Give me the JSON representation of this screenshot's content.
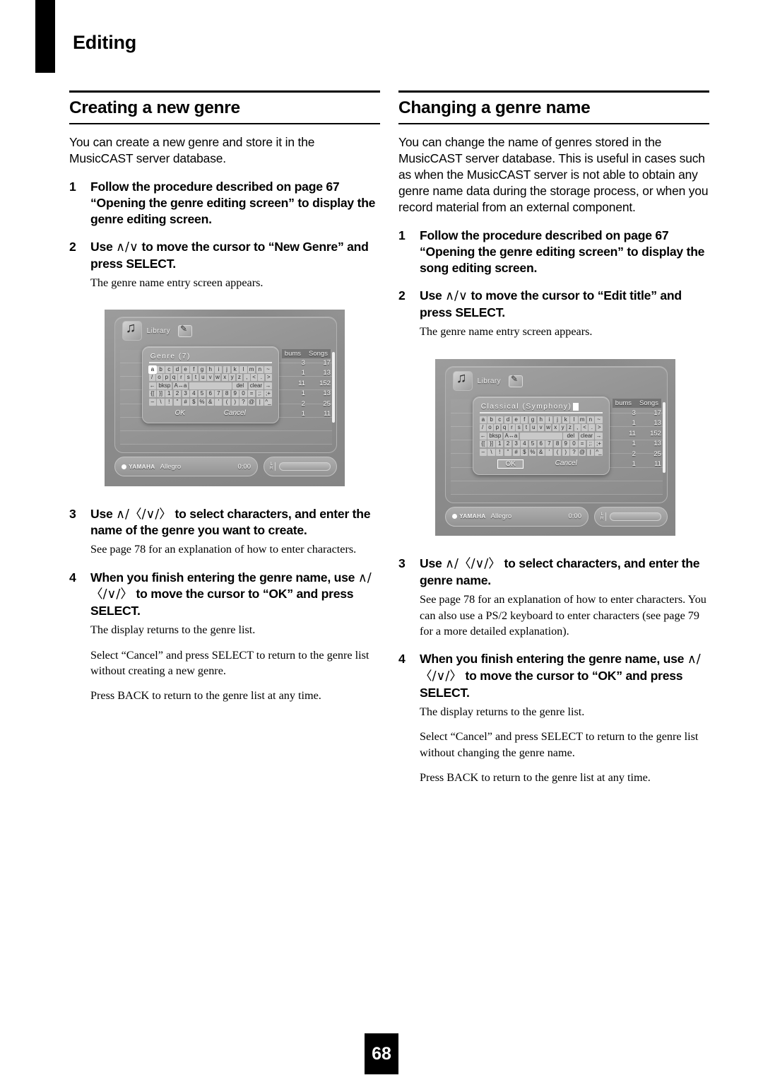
{
  "chapter": {
    "title": "Editing"
  },
  "footer": {
    "page_number": "68"
  },
  "left": {
    "heading": "Creating a new genre",
    "intro": "You can create a new genre and store it in the MusicCAST server database.",
    "steps": [
      {
        "num": "1",
        "title": "Follow the procedure described on page 67 “Opening the genre editing screen” to display the genre editing screen.",
        "notes": []
      },
      {
        "num": "2",
        "title_pre": "Use ",
        "title_glyph": "∧/∨",
        "title_post": " to move the cursor to “New Genre” and press SELECT.",
        "notes": [
          "The genre name entry screen appears."
        ]
      },
      {
        "num": "3",
        "title_pre": "Use ",
        "title_glyph": "∧/〈/∨/〉",
        "title_post": " to select characters, and enter the name of the genre you want to create.",
        "notes": [
          "See page 78 for an explanation of how to enter characters."
        ]
      },
      {
        "num": "4",
        "title_pre": "When you finish entering the genre name, use ",
        "title_glyph": "∧/〈/∨/〉",
        "title_post": " to move the cursor to “OK” and press SELECT.",
        "notes": [
          "The display returns to the genre list.",
          "Select “Cancel” and press SELECT to return to the genre list without creating a new genre.",
          "Press BACK to return to the genre list at any time."
        ]
      }
    ],
    "screenshot": {
      "header_label": "Library",
      "entry_text": "Genre (7)",
      "show_caret": false,
      "selected_key": "a",
      "ok_label": "OK",
      "cancel_label": "Cancel",
      "ok_selected": false,
      "col_headers": [
        "bums",
        "Songs"
      ],
      "stats": [
        [
          "3",
          "17"
        ],
        [
          "1",
          "13"
        ],
        [
          "11",
          "152"
        ],
        [
          "1",
          "13"
        ],
        [
          "2",
          "25"
        ],
        [
          "1",
          "11"
        ]
      ],
      "brand": "YAMAHA",
      "track": "Allegro",
      "time": "0:00",
      "vol_l": "L",
      "vol_r": "R"
    }
  },
  "right": {
    "heading": "Changing a genre name",
    "intro": "You can change the name of genres stored in the MusicCAST server database. This is useful in cases such as when the MusicCAST server is not able to obtain any genre name data during the storage process, or when you record material from an external component.",
    "steps": [
      {
        "num": "1",
        "title": "Follow the procedure described on page 67 “Opening the genre editing screen” to display the song editing screen.",
        "notes": []
      },
      {
        "num": "2",
        "title_pre": "Use ",
        "title_glyph": "∧/∨",
        "title_post": " to move the cursor to “Edit title” and press SELECT.",
        "notes": [
          "The genre name entry screen appears."
        ]
      },
      {
        "num": "3",
        "title_pre": "Use ",
        "title_glyph": "∧/〈/∨/〉",
        "title_post": " to select characters, and enter the genre name.",
        "notes": [
          "See page 78 for an explanation of how to enter characters. You can also use a PS/2 keyboard to enter characters (see page 79 for a more detailed explanation)."
        ]
      },
      {
        "num": "4",
        "title_pre": "When you finish entering the genre name, use ",
        "title_glyph": "∧/〈/∨/〉",
        "title_post": " to move the cursor to “OK” and press SELECT.",
        "notes": [
          "The display returns to the genre list.",
          "Select “Cancel” and press SELECT to return to the genre list without changing the genre name.",
          "Press BACK to return to the genre list at any time."
        ]
      }
    ],
    "screenshot": {
      "header_label": "Library",
      "entry_text": "Classical (Symphony)",
      "show_caret": true,
      "selected_key": "",
      "ok_label": "OK",
      "cancel_label": "Cancel",
      "ok_selected": true,
      "col_headers": [
        "bums",
        "Songs"
      ],
      "stats": [
        [
          "3",
          "17"
        ],
        [
          "1",
          "13"
        ],
        [
          "11",
          "152"
        ],
        [
          "1",
          "13"
        ],
        [
          "2",
          "25"
        ],
        [
          "1",
          "11"
        ]
      ],
      "brand": "YAMAHA",
      "track": "Allegro",
      "time": "0:00",
      "vol_l": "L",
      "vol_r": "R"
    }
  },
  "keyboard": {
    "rows": [
      [
        "a",
        "b",
        "c",
        "d",
        "e",
        "f",
        "g",
        "h",
        "i",
        "j",
        "k",
        "l",
        "m",
        "n",
        "~"
      ],
      [
        "/",
        "o",
        "p",
        "q",
        "r",
        "s",
        "t",
        "u",
        "v",
        "w",
        "x",
        "y",
        "z",
        ",",
        "<",
        ".",
        ">"
      ],
      [
        "←",
        "bksp",
        "A↔a",
        "",
        "del",
        "clear",
        "→"
      ],
      [
        "{[",
        "}]",
        "1",
        "2",
        "3",
        "4",
        "5",
        "6",
        "7",
        "8",
        "9",
        "0",
        "=",
        ";:",
        ";+"
      ],
      [
        "–",
        "\\",
        "!",
        "\"",
        "#",
        "$",
        "%",
        "&",
        "'",
        "(",
        ")",
        "?",
        "@",
        "|",
        "^_"
      ]
    ]
  }
}
